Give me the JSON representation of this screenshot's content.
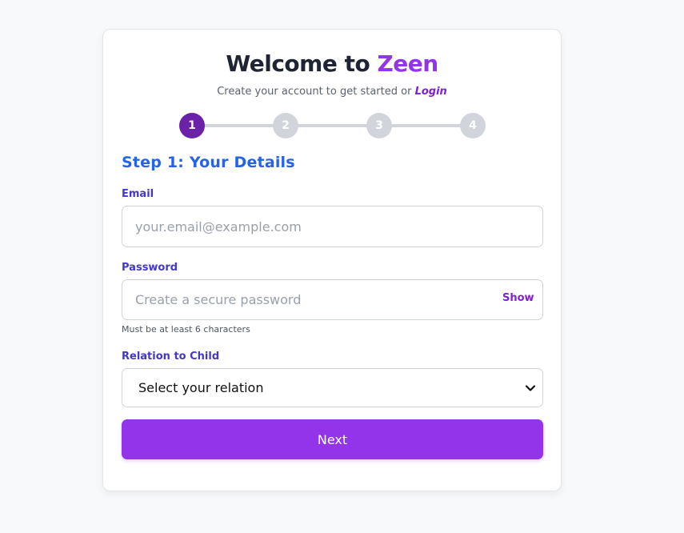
{
  "header": {
    "title_prefix": "Welcome to ",
    "brand": "Zeen",
    "subtitle_text": "Create your account to get started or ",
    "login_link": "Login"
  },
  "stepper": {
    "steps": [
      "1",
      "2",
      "3",
      "4"
    ],
    "active_step": 1
  },
  "step": {
    "heading": "Step 1: Your Details"
  },
  "form": {
    "email": {
      "label": "Email",
      "placeholder": "your.email@example.com",
      "value": ""
    },
    "password": {
      "label": "Password",
      "placeholder": "Create a secure password",
      "value": "",
      "toggle_label": "Show",
      "hint": "Must be at least 6 characters"
    },
    "relation": {
      "label": "Relation to Child",
      "selected": "Select your relation"
    },
    "submit_label": "Next"
  },
  "colors": {
    "brand": "#9333ea",
    "heading": "#2563eb",
    "label": "#4338ca",
    "active_step": "#6b21a8",
    "inactive_step": "#d1d5db"
  },
  "icons": {
    "select_arrow": "chevron-down-icon"
  }
}
